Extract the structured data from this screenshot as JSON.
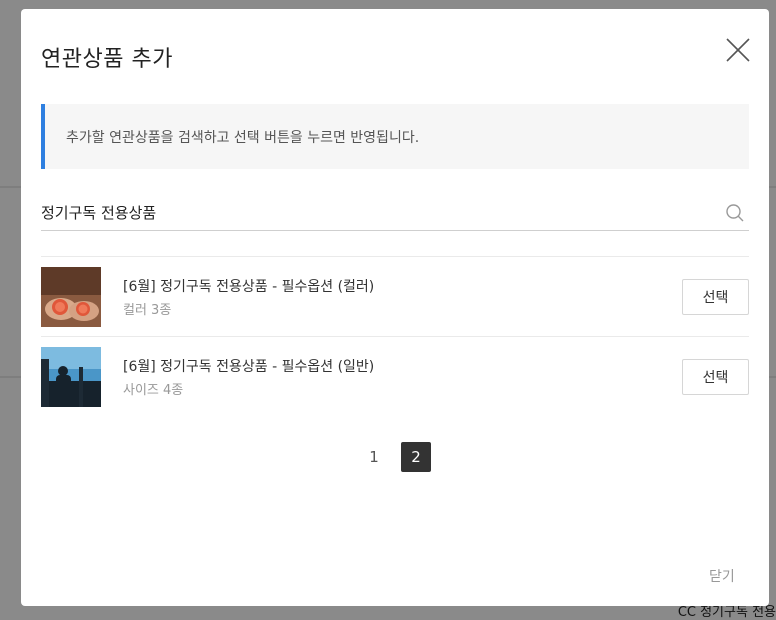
{
  "modal": {
    "title": "연관상품 추가",
    "notice": "추가할 연관상품을 검색하고 선택 버튼을 누르면 반영됩니다.",
    "close_label": "닫기"
  },
  "search": {
    "value": "정기구독 전용상품",
    "placeholder": ""
  },
  "items": [
    {
      "title": "[6월] 정기구독 전용상품 - 필수옵션 (컬러)",
      "subtitle": "컬러 3종",
      "button": "선택"
    },
    {
      "title": "[6월] 정기구독 전용상품 - 필수옵션 (일반)",
      "subtitle": "사이즈 4종",
      "button": "선택"
    }
  ],
  "pagination": {
    "pages": [
      "1",
      "2"
    ],
    "current": "2"
  },
  "background": {
    "partial_text": "CC 정기구독 전용"
  },
  "colors": {
    "accent": "#2e7fe0",
    "active_page": "#333333"
  }
}
